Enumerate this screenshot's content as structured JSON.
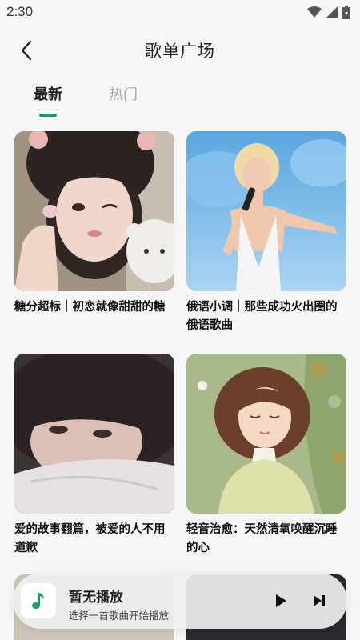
{
  "status_bar": {
    "time": "2:30"
  },
  "header": {
    "title": "歌单广场"
  },
  "tabs": [
    {
      "label": "最新",
      "active": true
    },
    {
      "label": "热门",
      "active": false
    }
  ],
  "playlists": [
    {
      "title": "糖分超标｜初恋就像甜甜的糖"
    },
    {
      "title": "俄语小调｜那些成功火出圈的俄语歌曲"
    },
    {
      "title": "爱的故事翻篇，被爱的人不用道歉"
    },
    {
      "title": "轻音治愈：天然清氧唤醒沉睡的心"
    }
  ],
  "player": {
    "title": "暂无播放",
    "subtitle": "选择一首歌曲开始播放"
  },
  "colors": {
    "accent": "#1a9c73",
    "background": "#f6f6f8"
  }
}
